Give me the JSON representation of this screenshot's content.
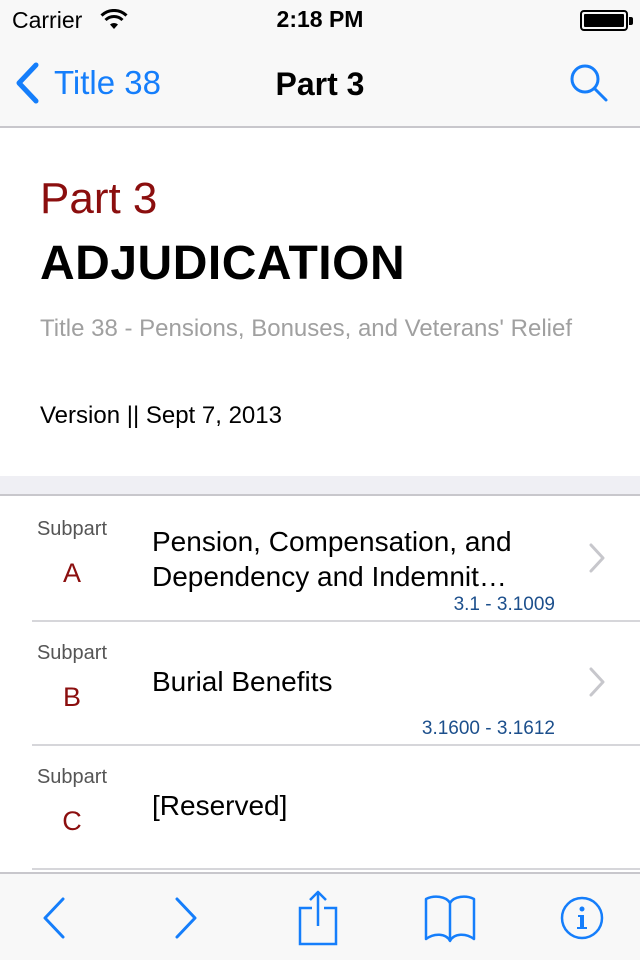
{
  "status_bar": {
    "carrier": "Carrier",
    "time": "2:18 PM",
    "wifi_icon": "wifi-icon",
    "battery_icon": "battery-icon"
  },
  "nav_bar": {
    "back_label": "Title 38",
    "back_icon": "chevron-left-icon",
    "title": "Part 3",
    "search_icon": "search-icon"
  },
  "header": {
    "part_label": "Part 3",
    "part_name": "ADJUDICATION",
    "title_text": "Title 38 - Pensions, Bonuses, and Veterans' Relief",
    "version": "Version || Sept 7, 2013"
  },
  "subparts": [
    {
      "label": "Subpart",
      "letter": "A",
      "title": "Pension, Compensation, and Dependency and Indemnit…",
      "range": "3.1 - 3.1009",
      "has_chevron": true
    },
    {
      "label": "Subpart",
      "letter": "B",
      "title": "Burial Benefits",
      "range": "3.1600 - 3.1612",
      "has_chevron": true
    },
    {
      "label": "Subpart",
      "letter": "C",
      "title": "[Reserved]",
      "range": "",
      "has_chevron": false
    }
  ],
  "toolbar": {
    "items": [
      "chevron-left-icon",
      "chevron-right-icon",
      "share-icon",
      "book-icon",
      "info-icon"
    ]
  },
  "colors": {
    "accent": "#157efb",
    "part_red": "#8b0e0e",
    "range_blue": "#1c4f8c",
    "subtitle_gray": "#a0a0a0",
    "bar_bg": "#f8f8f8",
    "group_bg": "#efeff4"
  }
}
